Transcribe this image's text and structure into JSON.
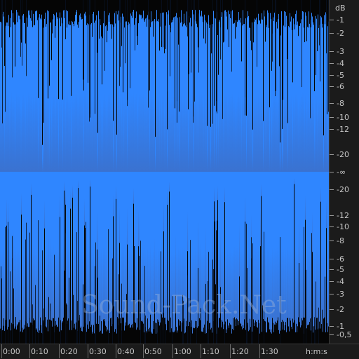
{
  "colors": {
    "background": "#050505",
    "waveform_top": "#2f86ff",
    "waveform_center": "#2f86ff",
    "waveform_bottom": "#3c78d8",
    "ruler_bg": "#1b1b1b",
    "ruler_text": "#c8c8c8"
  },
  "db_ruler": {
    "unit_label": "dB",
    "labels": [
      "-1",
      "-2",
      "-3",
      "-4",
      "-5",
      "-6",
      "-8",
      "-10",
      "-12",
      "-20",
      "-∞",
      "-20",
      "-12",
      "-10",
      "-8",
      "-6",
      "-5",
      "-4",
      "-3",
      "-2",
      "-1",
      "-0,5"
    ]
  },
  "time_ruler": {
    "labels": [
      "0:00",
      "0:10",
      "0:20",
      "0:30",
      "0:40",
      "0:50",
      "1:00",
      "1:10",
      "1:20",
      "1:30"
    ],
    "unit_label": "h:m:s"
  },
  "watermark": {
    "text": "Sound-Pack.Net"
  }
}
